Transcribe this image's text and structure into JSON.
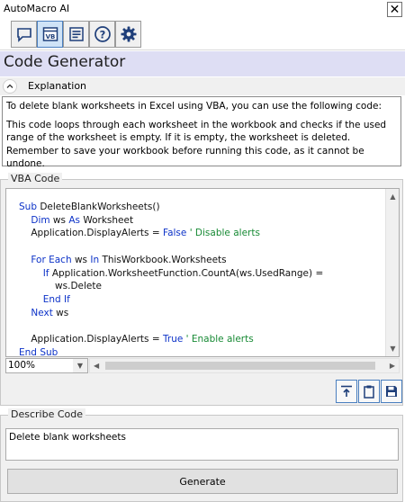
{
  "window": {
    "title": "AutoMacro AI",
    "close_symbol": "✕"
  },
  "toolbar": {
    "buttons": [
      {
        "icon": "chat-icon"
      },
      {
        "icon": "vb-editor-icon",
        "badge": "VB"
      },
      {
        "icon": "document-list-icon"
      },
      {
        "icon": "help-icon",
        "glyph": "?"
      },
      {
        "icon": "gear-icon"
      }
    ]
  },
  "page": {
    "title": "Code Generator"
  },
  "explanation": {
    "label": "Explanation",
    "paragraphs": [
      "To delete blank worksheets in Excel using VBA, you can use the following code:",
      "This code loops through each worksheet in the workbook and checks if the used range of the worksheet is empty. If it is empty, the worksheet is deleted. Remember to save your workbook before running this code, as it cannot be undone."
    ]
  },
  "vba": {
    "label": "VBA Code",
    "zoom": "100%",
    "code_lines": [
      "Sub DeleteBlankWorksheets()",
      "    Dim ws As Worksheet",
      "    Application.DisplayAlerts = False ' Disable alerts",
      "",
      "    For Each ws In ThisWorkbook.Worksheets",
      "        If Application.WorksheetFunction.CountA(ws.UsedRange) =",
      "            ws.Delete",
      "        End If",
      "    Next ws",
      "",
      "    Application.DisplayAlerts = True ' Enable alerts",
      "End Sub"
    ],
    "actions": [
      {
        "icon": "insert-code-icon"
      },
      {
        "icon": "clipboard-icon"
      },
      {
        "icon": "save-icon"
      }
    ]
  },
  "describe": {
    "label": "Describe Code",
    "value": "Delete blank worksheets",
    "button_label": "Generate"
  },
  "colors": {
    "header_bg": "#dedef4",
    "keyword": "#0c32c8",
    "comment": "#178a34",
    "accent_border": "#4a7fbf"
  }
}
